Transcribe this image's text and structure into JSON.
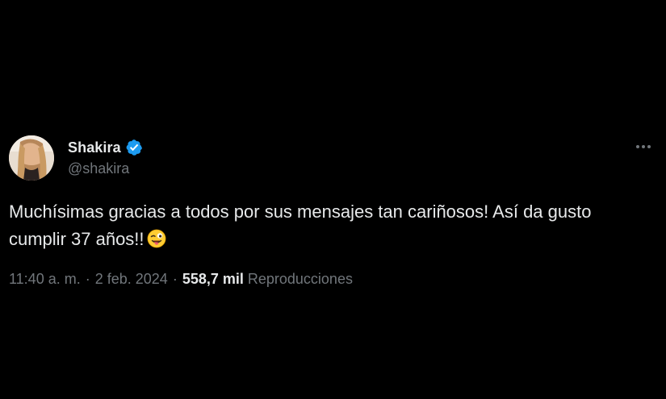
{
  "author": {
    "display_name": "Shakira",
    "handle": "@shakira",
    "verified": true,
    "verified_color": "#1d9bf0"
  },
  "tweet": {
    "text": "Muchísimas gracias a todos por sus mensajes tan cariñosos! Así da gusto cumplir 37 años!!",
    "emoji": "winking-face-with-tongue"
  },
  "meta": {
    "time": "11:40 a. m.",
    "separator": "·",
    "date": "2 feb. 2024",
    "views_count": "558,7 mil",
    "views_label": "Reproducciones"
  },
  "icons": {
    "more": "more-horizontal-icon",
    "verified": "verified-badge-icon"
  },
  "colors": {
    "background": "#000000",
    "primary_text": "#e7e9ea",
    "secondary_text": "#71767b"
  }
}
